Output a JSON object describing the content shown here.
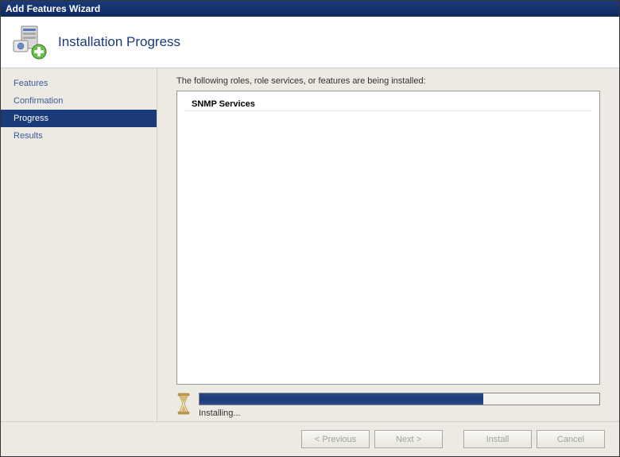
{
  "window": {
    "title": "Add Features Wizard"
  },
  "header": {
    "title": "Installation Progress"
  },
  "sidebar": {
    "items": [
      {
        "label": "Features"
      },
      {
        "label": "Confirmation"
      },
      {
        "label": "Progress"
      },
      {
        "label": "Results"
      }
    ],
    "activeIndex": 2
  },
  "main": {
    "description": "The following roles, role services, or features are being installed:",
    "installItems": [
      {
        "label": "SNMP Services"
      }
    ],
    "progress": {
      "percent": 71,
      "status": "Installing..."
    }
  },
  "footer": {
    "buttons": {
      "previous": "< Previous",
      "next": "Next >",
      "install": "Install",
      "cancel": "Cancel"
    }
  }
}
